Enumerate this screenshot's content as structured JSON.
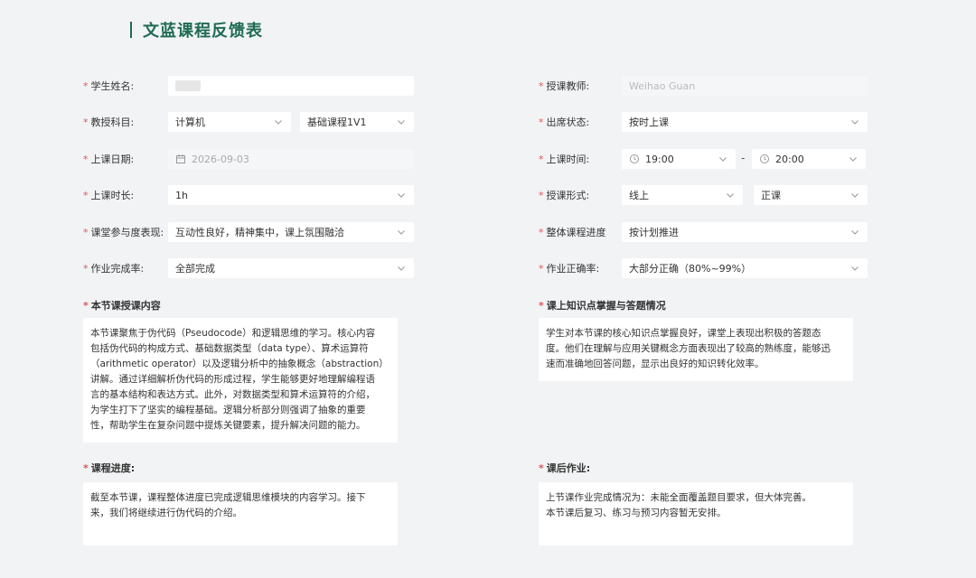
{
  "title": "文蓝课程反馈表",
  "required_mark": "*",
  "labels": {
    "student_name": "学生姓名:",
    "teacher": "授课教师:",
    "subject": "教授科目:",
    "attendance": "出席状态:",
    "date": "上课日期:",
    "time": "上课时间:",
    "duration": "上课时长:",
    "mode": "授课形式:",
    "participation": "课堂参与度表现:",
    "progress_overall": "整体课程进度",
    "homework_completion": "作业完成率:",
    "homework_accuracy": "作业正确率:"
  },
  "values": {
    "teacher": "Weihao Guan",
    "subject": "计算机",
    "course": "基础课程1V1",
    "attendance": "按时上课",
    "date": "2026-09-03",
    "time_start": "19:00",
    "time_end": "20:00",
    "time_separator": "-",
    "duration": "1h",
    "mode": "线上",
    "mode_type": "正课",
    "participation": "互动性良好，精神集中，课上氛围融洽",
    "progress_overall": "按计划推进",
    "homework_completion": "全部完成",
    "homework_accuracy": "大部分正确（80%~99%）"
  },
  "sections": {
    "lesson_content": {
      "title": "本节课授课内容",
      "text": "本节课聚焦于伪代码（Pseudocode）和逻辑思维的学习。核心内容\n包括伪代码的构成方式、基础数据类型（data type）、算术运算符\n（arithmetic operator）以及逻辑分析中的抽象概念（abstraction）\n讲解。通过详细解析伪代码的形成过程，学生能够更好地理解编程语\n言的基本结构和表达方式。此外，对数据类型和算术运算符的介绍，\n为学生打下了坚实的编程基础。逻辑分析部分则强调了抽象的重要\n性，帮助学生在复杂问题中提炼关键要素，提升解决问题的能力。"
    },
    "knowledge": {
      "title": "课上知识点掌握与答题情况",
      "text": "学生对本节课的核心知识点掌握良好，课堂上表现出积极的答题态\n度。他们在理解与应用关键概念方面表现出了较高的熟练度，能够迅\n速而准确地回答问题，显示出良好的知识转化效率。"
    },
    "progress": {
      "title": "课程进度:",
      "text": "截至本节课，课程整体进度已完成逻辑思维模块的内容学习。接下\n来，我们将继续进行伪代码的介绍。"
    },
    "homework": {
      "title": "课后作业:",
      "text": "上节课作业完成情况为：未能全面覆盖题目要求，但大体完善。\n本节课后复习、练习与预习内容暂无安排。"
    }
  },
  "colors": {
    "accent": "#1f6b52",
    "required": "#e05656",
    "background": "#f1f3f5"
  }
}
